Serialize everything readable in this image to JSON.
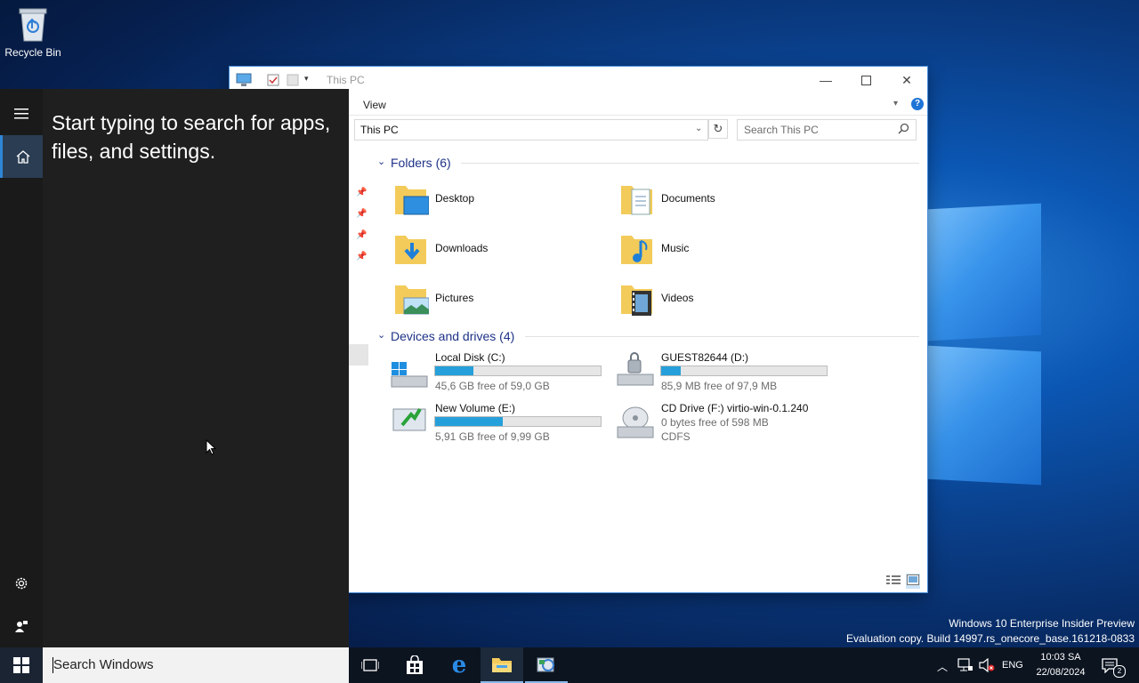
{
  "desktop": {
    "recycle_bin_label": "Recycle Bin",
    "watermark_line1": "Windows 10 Enterprise Insider Preview",
    "watermark_line2": "Evaluation copy. Build 14997.rs_onecore_base.161218-0833"
  },
  "explorer": {
    "title": "This PC",
    "ribbon_tab": "View",
    "address": "This PC",
    "search_placeholder": "Search This PC",
    "folders_header": "Folders (6)",
    "folders": [
      {
        "name": "Desktop",
        "icon": "desktop-folder-icon"
      },
      {
        "name": "Documents",
        "icon": "documents-folder-icon"
      },
      {
        "name": "Downloads",
        "icon": "downloads-folder-icon"
      },
      {
        "name": "Music",
        "icon": "music-folder-icon"
      },
      {
        "name": "Pictures",
        "icon": "pictures-folder-icon"
      },
      {
        "name": "Videos",
        "icon": "videos-folder-icon"
      }
    ],
    "drives_header": "Devices and drives (4)",
    "drives": [
      {
        "name": "Local Disk (C:)",
        "free": "45,6 GB free of 59,0 GB",
        "used_fraction": 0.23
      },
      {
        "name": "GUEST82644 (D:)",
        "free": "85,9 MB free of 97,9 MB",
        "used_fraction": 0.12
      },
      {
        "name": "New Volume (E:)",
        "free": "5,91 GB free of 9,99 GB",
        "used_fraction": 0.41
      },
      {
        "name": "CD Drive (F:) virtio-win-0.1.240",
        "free": "0 bytes free of 598 MB",
        "fs": "CDFS"
      }
    ]
  },
  "start_menu": {
    "message": "Start typing to search for apps, files, and settings.",
    "search_placeholder": "Search Windows"
  },
  "taskbar": {
    "language": "ENG",
    "time": "10:03 SA",
    "date": "22/08/2024",
    "notification_count": "2"
  },
  "colors": {
    "accent": "#26a0da",
    "section_header": "#1e3287",
    "start_bg": "#1f1f1f",
    "taskbar_bg": "#0c1420"
  }
}
